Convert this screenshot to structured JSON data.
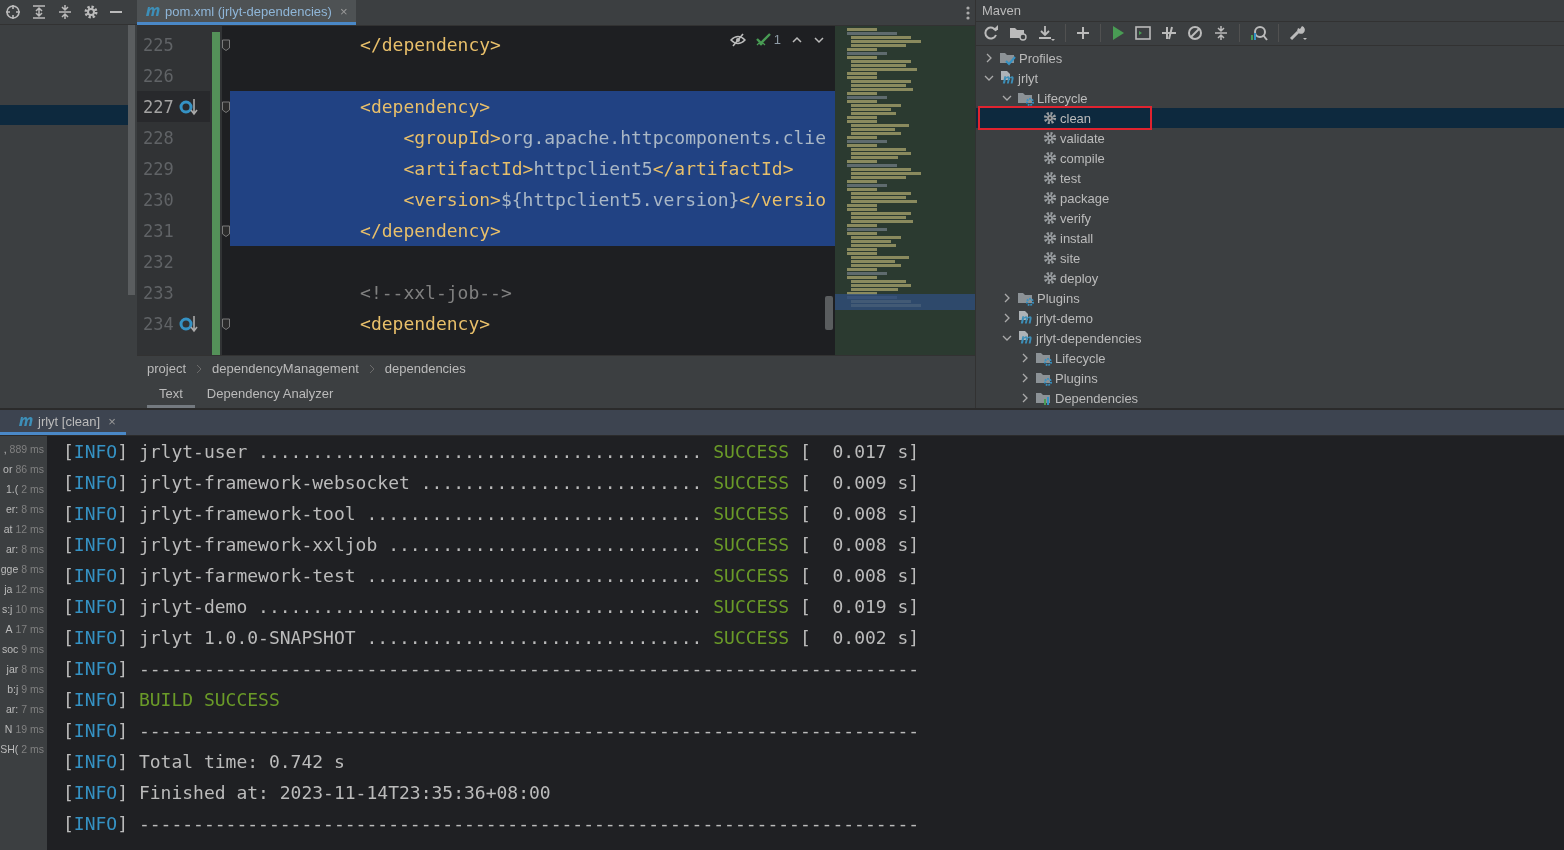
{
  "editor": {
    "tab": {
      "title": "pom.xml (jrlyt-dependencies)",
      "close": "×",
      "selected": true
    },
    "inspection": {
      "count": "1"
    },
    "lines": [
      {
        "number": "225",
        "current": false,
        "selected": false,
        "fold": true,
        "gutter_icon": false,
        "parts": [
          {
            "kind": "tag",
            "text": "            </dependency>"
          }
        ]
      },
      {
        "number": "226",
        "current": false,
        "selected": false,
        "fold": false,
        "gutter_icon": false
      },
      {
        "number": "227",
        "current": true,
        "selected": true,
        "fold": true,
        "gutter_icon": true,
        "parts": [
          {
            "kind": "tag",
            "text": "            <dependency>"
          }
        ]
      },
      {
        "number": "228",
        "current": false,
        "selected": true,
        "fold": false,
        "gutter_icon": false,
        "parts": [
          {
            "kind": "tag",
            "text": "                <groupId>"
          },
          {
            "kind": "text",
            "text": "org.apache.httpcomponents.clie"
          }
        ]
      },
      {
        "number": "229",
        "current": false,
        "selected": true,
        "fold": false,
        "gutter_icon": false,
        "parts": [
          {
            "kind": "tag",
            "text": "                <artifactId>"
          },
          {
            "kind": "text",
            "text": "httpclient5"
          },
          {
            "kind": "tag",
            "text": "</artifactId>"
          }
        ]
      },
      {
        "number": "230",
        "current": false,
        "selected": true,
        "fold": false,
        "gutter_icon": false,
        "parts": [
          {
            "kind": "tag",
            "text": "                <version>"
          },
          {
            "kind": "text",
            "text": "${httpclient5.version}"
          },
          {
            "kind": "tag",
            "text": "</versio"
          }
        ]
      },
      {
        "number": "231",
        "current": false,
        "selected": true,
        "fold": true,
        "gutter_icon": false,
        "parts": [
          {
            "kind": "tag",
            "text": "            </dependency>"
          }
        ]
      },
      {
        "number": "232",
        "current": false,
        "selected": false,
        "fold": false,
        "gutter_icon": false
      },
      {
        "number": "233",
        "current": false,
        "selected": false,
        "fold": false,
        "gutter_icon": false,
        "parts": [
          {
            "kind": "comment",
            "text": "            <!--xxl-job-->"
          }
        ]
      },
      {
        "number": "234",
        "current": false,
        "selected": false,
        "fold": true,
        "gutter_icon": true,
        "parts": [
          {
            "kind": "tag",
            "text": "            <dependency>"
          }
        ]
      }
    ],
    "breadcrumbs": [
      "project",
      "dependencyManagement",
      "dependencies"
    ],
    "view_tabs": [
      {
        "label": "Text",
        "selected": true
      },
      {
        "label": "Dependency Analyzer",
        "selected": false
      }
    ]
  },
  "maven": {
    "title": "Maven",
    "tree": [
      {
        "label": "Profiles",
        "kind": "profiles",
        "expanded": false,
        "selected": false,
        "highlighted": false
      },
      {
        "label": "jrlyt",
        "kind": "module",
        "expanded": true,
        "selected": false,
        "highlighted": false,
        "children": [
          {
            "label": "Lifecycle",
            "kind": "folder",
            "expanded": true,
            "selected": false,
            "highlighted": false,
            "children": [
              {
                "label": "clean",
                "kind": "goal",
                "selected": true,
                "highlighted": true
              },
              {
                "label": "validate",
                "kind": "goal",
                "selected": false,
                "highlighted": false
              },
              {
                "label": "compile",
                "kind": "goal",
                "selected": false,
                "highlighted": false
              },
              {
                "label": "test",
                "kind": "goal",
                "selected": false,
                "highlighted": false
              },
              {
                "label": "package",
                "kind": "goal",
                "selected": false,
                "highlighted": false
              },
              {
                "label": "verify",
                "kind": "goal",
                "selected": false,
                "highlighted": false
              },
              {
                "label": "install",
                "kind": "goal",
                "selected": false,
                "highlighted": false
              },
              {
                "label": "site",
                "kind": "goal",
                "selected": false,
                "highlighted": false
              },
              {
                "label": "deploy",
                "kind": "goal",
                "selected": false,
                "highlighted": false
              }
            ]
          },
          {
            "label": "Plugins",
            "kind": "folder",
            "expanded": false,
            "selected": false,
            "highlighted": false
          },
          {
            "label": "jrlyt-demo",
            "kind": "module",
            "expanded": false,
            "selected": false,
            "highlighted": false
          },
          {
            "label": "jrlyt-dependencies",
            "kind": "module",
            "expanded": true,
            "selected": false,
            "highlighted": false,
            "children": [
              {
                "label": "Lifecycle",
                "kind": "folder",
                "expanded": false,
                "selected": false,
                "highlighted": false
              },
              {
                "label": "Plugins",
                "kind": "folder",
                "expanded": false,
                "selected": false,
                "highlighted": false
              },
              {
                "label": "Dependencies",
                "kind": "dependencies",
                "expanded": false,
                "selected": false,
                "highlighted": false
              }
            ]
          }
        ]
      }
    ]
  },
  "run": {
    "tab": {
      "title": "jrlyt [clean]",
      "close": "×",
      "selected": true
    },
    "timings": [
      {
        "label": ",",
        "time": "889 ms"
      },
      {
        "label": "or",
        "time": "86 ms"
      },
      {
        "label": "1.(",
        "time": "2 ms"
      },
      {
        "label": "er:",
        "time": "8 ms"
      },
      {
        "label": "at",
        "time": "12 ms"
      },
      {
        "label": "ar:",
        "time": "8 ms"
      },
      {
        "label": "gge",
        "time": "8 ms"
      },
      {
        "label": "ja",
        "time": "12 ms"
      },
      {
        "label": "s:j",
        "time": "10 ms"
      },
      {
        "label": "A",
        "time": "17 ms"
      },
      {
        "label": "soc",
        "time": "9 ms"
      },
      {
        "label": "jar",
        "time": "8 ms"
      },
      {
        "label": "b:j",
        "time": "9 ms"
      },
      {
        "label": "ar:",
        "time": "7 ms"
      },
      {
        "label": "N",
        "time": "19 ms"
      },
      {
        "label": "SH(",
        "time": "2 ms"
      }
    ],
    "console": [
      {
        "parts": [
          {
            "kind": "bracket",
            "text": "["
          },
          {
            "kind": "level",
            "text": "INFO"
          },
          {
            "kind": "bracket",
            "text": "]"
          },
          {
            "kind": "text",
            "text": " jrlyt-user ......................................... "
          },
          {
            "kind": "success",
            "text": "SUCCESS"
          },
          {
            "kind": "text",
            "text": " [  0.017 s]"
          }
        ]
      },
      {
        "parts": [
          {
            "kind": "bracket",
            "text": "["
          },
          {
            "kind": "level",
            "text": "INFO"
          },
          {
            "kind": "bracket",
            "text": "]"
          },
          {
            "kind": "text",
            "text": " jrlyt-framework-websocket .......................... "
          },
          {
            "kind": "success",
            "text": "SUCCESS"
          },
          {
            "kind": "text",
            "text": " [  0.009 s]"
          }
        ]
      },
      {
        "parts": [
          {
            "kind": "bracket",
            "text": "["
          },
          {
            "kind": "level",
            "text": "INFO"
          },
          {
            "kind": "bracket",
            "text": "]"
          },
          {
            "kind": "text",
            "text": " jrlyt-framework-tool ............................... "
          },
          {
            "kind": "success",
            "text": "SUCCESS"
          },
          {
            "kind": "text",
            "text": " [  0.008 s]"
          }
        ]
      },
      {
        "parts": [
          {
            "kind": "bracket",
            "text": "["
          },
          {
            "kind": "level",
            "text": "INFO"
          },
          {
            "kind": "bracket",
            "text": "]"
          },
          {
            "kind": "text",
            "text": " jrlyt-framework-xxljob ............................. "
          },
          {
            "kind": "success",
            "text": "SUCCESS"
          },
          {
            "kind": "text",
            "text": " [  0.008 s]"
          }
        ]
      },
      {
        "parts": [
          {
            "kind": "bracket",
            "text": "["
          },
          {
            "kind": "level",
            "text": "INFO"
          },
          {
            "kind": "bracket",
            "text": "]"
          },
          {
            "kind": "text",
            "text": " jrlyt-farmework-test ............................... "
          },
          {
            "kind": "success",
            "text": "SUCCESS"
          },
          {
            "kind": "text",
            "text": " [  0.008 s]"
          }
        ]
      },
      {
        "parts": [
          {
            "kind": "bracket",
            "text": "["
          },
          {
            "kind": "level",
            "text": "INFO"
          },
          {
            "kind": "bracket",
            "text": "]"
          },
          {
            "kind": "text",
            "text": " jrlyt-demo ......................................... "
          },
          {
            "kind": "success",
            "text": "SUCCESS"
          },
          {
            "kind": "text",
            "text": " [  0.019 s]"
          }
        ]
      },
      {
        "parts": [
          {
            "kind": "bracket",
            "text": "["
          },
          {
            "kind": "level",
            "text": "INFO"
          },
          {
            "kind": "bracket",
            "text": "]"
          },
          {
            "kind": "text",
            "text": " jrlyt 1.0.0-SNAPSHOT ............................... "
          },
          {
            "kind": "success",
            "text": "SUCCESS"
          },
          {
            "kind": "text",
            "text": " [  0.002 s]"
          }
        ]
      },
      {
        "parts": [
          {
            "kind": "bracket",
            "text": "["
          },
          {
            "kind": "level",
            "text": "INFO"
          },
          {
            "kind": "bracket",
            "text": "]"
          },
          {
            "kind": "text",
            "text": " ------------------------------------------------------------------------"
          }
        ]
      },
      {
        "parts": [
          {
            "kind": "bracket",
            "text": "["
          },
          {
            "kind": "level",
            "text": "INFO"
          },
          {
            "kind": "bracket",
            "text": "] "
          },
          {
            "kind": "success",
            "text": "BUILD SUCCESS"
          }
        ]
      },
      {
        "parts": [
          {
            "kind": "bracket",
            "text": "["
          },
          {
            "kind": "level",
            "text": "INFO"
          },
          {
            "kind": "bracket",
            "text": "]"
          },
          {
            "kind": "text",
            "text": " ------------------------------------------------------------------------"
          }
        ]
      },
      {
        "parts": [
          {
            "kind": "bracket",
            "text": "["
          },
          {
            "kind": "level",
            "text": "INFO"
          },
          {
            "kind": "bracket",
            "text": "]"
          },
          {
            "kind": "text",
            "text": " Total time: 0.742 s"
          }
        ]
      },
      {
        "parts": [
          {
            "kind": "bracket",
            "text": "["
          },
          {
            "kind": "level",
            "text": "INFO"
          },
          {
            "kind": "bracket",
            "text": "]"
          },
          {
            "kind": "text",
            "text": " Finished at: 2023-11-14T23:35:36+08:00"
          }
        ]
      },
      {
        "parts": [
          {
            "kind": "bracket",
            "text": "["
          },
          {
            "kind": "level",
            "text": "INFO"
          },
          {
            "kind": "bracket",
            "text": "]"
          },
          {
            "kind": "text",
            "text": " ------------------------------------------------------------------------"
          }
        ]
      }
    ]
  }
}
